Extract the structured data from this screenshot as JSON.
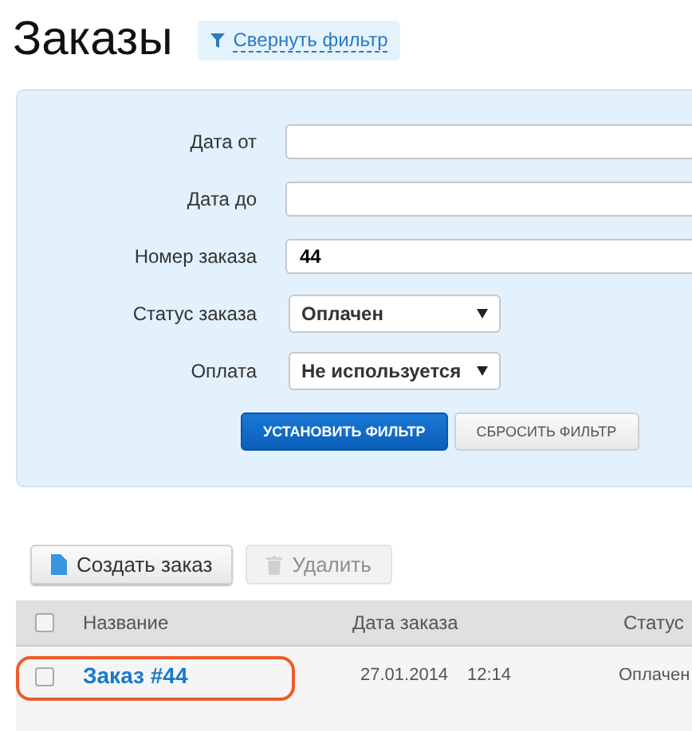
{
  "title": "Заказы",
  "filter_toggle": {
    "label": "Свернуть фильтр"
  },
  "filter": {
    "fields": [
      {
        "kind": "text",
        "label": "Дата от"
      },
      {
        "kind": "text",
        "label": "Дата до"
      },
      {
        "kind": "text",
        "label": "Номер заказа",
        "value": "44"
      },
      {
        "kind": "select",
        "label": "Статус заказа",
        "value": "Оплачен"
      },
      {
        "kind": "select",
        "label": "Оплата",
        "value": "Не используется"
      }
    ],
    "apply_button": "УСТАНОВИТЬ ФИЛЬТР",
    "reset_button": "СБРОСИТЬ ФИЛЬТР"
  },
  "toolbar": [
    {
      "kind": "create",
      "label": "Создать заказ",
      "disabled": false
    },
    {
      "kind": "delete",
      "label": "Удалить",
      "disabled": true
    }
  ],
  "table": {
    "select_all_checked": false,
    "columns": [
      "Название",
      "Дата заказа",
      "Статус"
    ],
    "rows": [
      {
        "checked": false,
        "highlighted": true,
        "name": "Заказ #44",
        "date": "27.01.2014",
        "time": "12:14",
        "status": "Оплачен"
      }
    ]
  }
}
